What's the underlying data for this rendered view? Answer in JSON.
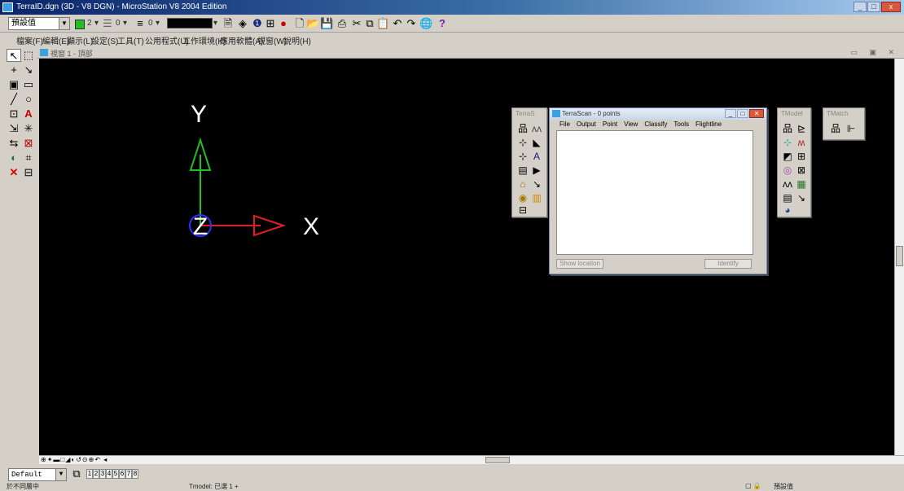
{
  "window": {
    "title": "TerraID.dgn (3D - V8 DGN) - MicroStation V8 2004 Edition",
    "controls": [
      "_",
      "□",
      "x"
    ]
  },
  "toolbar": {
    "level_combo": "預設值",
    "color_value": "2",
    "style_value": "0",
    "weight_value": "0",
    "help_icon": "?"
  },
  "menubar": {
    "items": [
      "檔案(F)",
      "編輯(E)",
      "顯示(L)",
      "設定(S)",
      "工具(T)",
      "公用程式(U)",
      "工作環境(K)",
      "應用軟體(A)",
      "視窗(W)",
      "說明(H)"
    ]
  },
  "view": {
    "title": "視窗 1 - 頂部"
  },
  "axes": {
    "x_label": "X",
    "y_label": "Y",
    "z_label": "Z",
    "colors": {
      "x": "#e02020",
      "y": "#20c020",
      "z": "#3030ff",
      "label": "#ffffff"
    }
  },
  "palettes": {
    "terrascan_tools": "TerraS",
    "tmodel": "TModel",
    "tmatch": "TMatch"
  },
  "terrascan_window": {
    "title": "TerraScan - 0 points",
    "menu": [
      "File",
      "Output",
      "Point",
      "View",
      "Classify",
      "Tools",
      "Flightline"
    ],
    "show_location_label": "Show location",
    "identify_label": "Identify"
  },
  "bottom": {
    "model_combo": "Default",
    "view_buttons": [
      "1",
      "2",
      "3",
      "4",
      "5",
      "6",
      "7",
      "8"
    ],
    "status_left": "於不同層中",
    "status_mid": "Tmodel: 已選 1 +",
    "status_right": "預設值"
  }
}
